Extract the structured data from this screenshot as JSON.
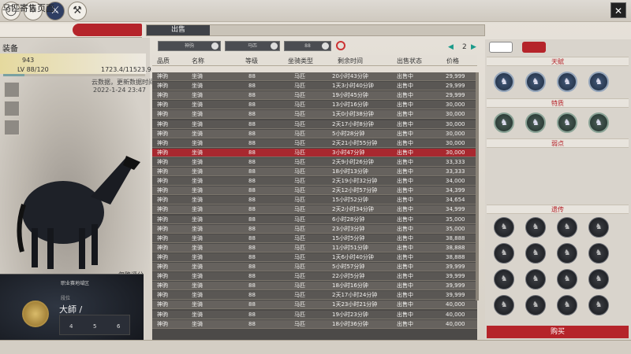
{
  "window": {
    "title": "马匹寄售页面",
    "close": "✕"
  },
  "top_icons": [
    "ring-icon",
    "compass-icon",
    "sword-icon",
    "axe-icon"
  ],
  "tabs": {
    "sell": "出售"
  },
  "equip": {
    "label": "装备",
    "hp": "943",
    "lv": "LV 88/120",
    "xp": "1723.4/11523.9",
    "xp_fraction": 0.15
  },
  "notes": {
    "line1": "云数据，更新数据时间",
    "line2": "2022-1-24 23:47"
  },
  "ignore_text": "忽略评分",
  "portrait": {
    "title": "职业赛地域区",
    "subtitle": "段位",
    "name": "大師 / ",
    "stats": [
      "4",
      "5",
      "6"
    ]
  },
  "filters": {
    "dropdowns": [
      "神驹",
      "马匹",
      "88"
    ],
    "page": "2"
  },
  "table": {
    "headers": [
      "品质",
      "名称",
      "等级",
      "坐骑类型",
      "剩余时间",
      "出售状态",
      "价格"
    ],
    "rows": [
      [
        "神驹",
        "坐骑",
        "88",
        "马匹",
        "20小时43分钟",
        "出售中",
        "29,999"
      ],
      [
        "神驹",
        "坐骑",
        "88",
        "马匹",
        "1天3小时40分钟",
        "出售中",
        "29,999"
      ],
      [
        "神驹",
        "坐骑",
        "88",
        "马匹",
        "19小时45分钟",
        "出售中",
        "29,999"
      ],
      [
        "神驹",
        "坐骑",
        "88",
        "马匹",
        "13小时16分钟",
        "出售中",
        "30,000"
      ],
      [
        "神驹",
        "坐骑",
        "88",
        "马匹",
        "1天0小时38分钟",
        "出售中",
        "30,000"
      ],
      [
        "神驹",
        "坐骑",
        "88",
        "马匹",
        "2天17小时8分钟",
        "出售中",
        "30,000"
      ],
      [
        "神驹",
        "坐骑",
        "88",
        "马匹",
        "5小时28分钟",
        "出售中",
        "30,000"
      ],
      [
        "神驹",
        "坐骑",
        "88",
        "马匹",
        "2天21小时55分钟",
        "出售中",
        "30,000"
      ],
      [
        "神驹",
        "坐骑",
        "88",
        "马匹",
        "3小时47分钟",
        "出售中",
        "30,000"
      ],
      [
        "神驹",
        "坐骑",
        "88",
        "马匹",
        "2天9小时26分钟",
        "出售中",
        "33,333"
      ],
      [
        "神驹",
        "坐骑",
        "88",
        "马匹",
        "18小时13分钟",
        "出售中",
        "33,333"
      ],
      [
        "神驹",
        "坐骑",
        "88",
        "马匹",
        "2天19小时32分钟",
        "出售中",
        "34,000"
      ],
      [
        "神驹",
        "坐骑",
        "88",
        "马匹",
        "2天12小时57分钟",
        "出售中",
        "34,399"
      ],
      [
        "神驹",
        "坐骑",
        "88",
        "马匹",
        "15小时52分钟",
        "出售中",
        "34,654"
      ],
      [
        "神驹",
        "坐骑",
        "88",
        "马匹",
        "2天2小时34分钟",
        "出售中",
        "34,999"
      ],
      [
        "神驹",
        "坐骑",
        "88",
        "马匹",
        "6小时28分钟",
        "出售中",
        "35,000"
      ],
      [
        "神驹",
        "坐骑",
        "88",
        "马匹",
        "23小时3分钟",
        "出售中",
        "35,000"
      ],
      [
        "神驹",
        "坐骑",
        "88",
        "马匹",
        "15小时5分钟",
        "出售中",
        "38,888"
      ],
      [
        "神驹",
        "坐骑",
        "88",
        "马匹",
        "11小时51分钟",
        "出售中",
        "38,888"
      ],
      [
        "神驹",
        "坐骑",
        "88",
        "马匹",
        "1天6小时40分钟",
        "出售中",
        "38,888"
      ],
      [
        "神驹",
        "坐骑",
        "88",
        "马匹",
        "5小时57分钟",
        "出售中",
        "39,999"
      ],
      [
        "神驹",
        "坐骑",
        "88",
        "马匹",
        "22小时5分钟",
        "出售中",
        "39,999"
      ],
      [
        "神驹",
        "坐骑",
        "88",
        "马匹",
        "18小时16分钟",
        "出售中",
        "39,999"
      ],
      [
        "神驹",
        "坐骑",
        "88",
        "马匹",
        "2天17小时24分钟",
        "出售中",
        "39,999"
      ],
      [
        "神驹",
        "坐骑",
        "88",
        "马匹",
        "1天23小时21分钟",
        "出售中",
        "40,000"
      ],
      [
        "神驹",
        "坐骑",
        "88",
        "马匹",
        "19小时23分钟",
        "出售中",
        "40,000"
      ],
      [
        "神驹",
        "坐骑",
        "88",
        "马匹",
        "18小时36分钟",
        "出售中",
        "40,000"
      ]
    ],
    "selected_index": 8
  },
  "right": {
    "talent_title": "天赋",
    "trait_title": "特质",
    "weak_title": "弱点",
    "gene_title": "遗传",
    "buy_label": "购买"
  },
  "colors": {
    "accent": "#b5242a",
    "row_dark": "#4c4a48",
    "teal": "#1a9a8a"
  }
}
